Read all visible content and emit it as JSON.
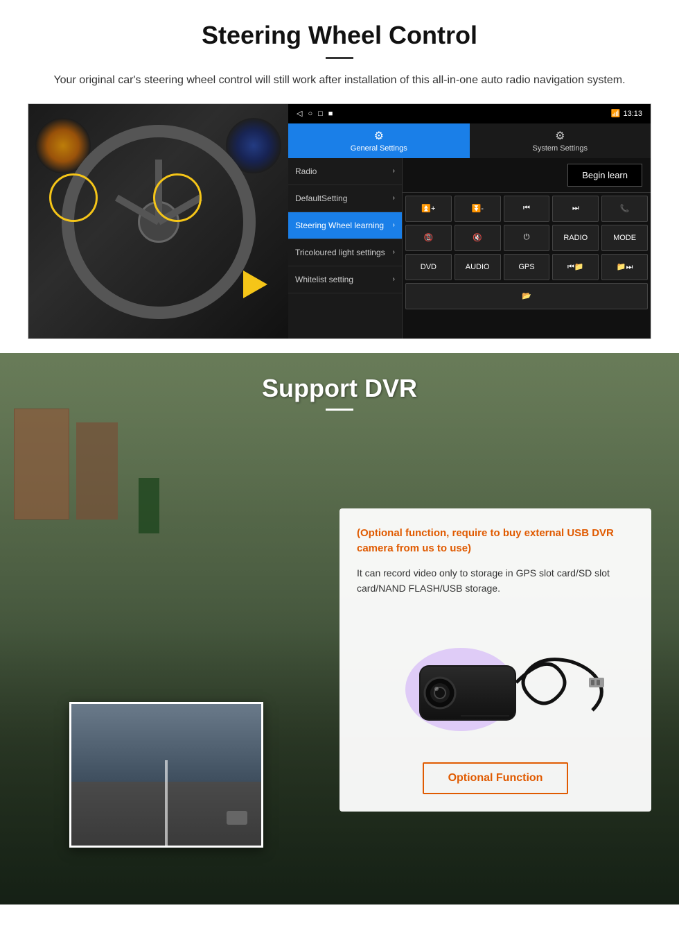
{
  "section1": {
    "title": "Steering Wheel Control",
    "subtitle": "Your original car's steering wheel control will still work after installation of this all-in-one auto radio navigation system.",
    "tabs": {
      "general": "General Settings",
      "system": "System Settings"
    },
    "menu": {
      "items": [
        {
          "label": "Radio",
          "active": false
        },
        {
          "label": "DefaultSetting",
          "active": false
        },
        {
          "label": "Steering Wheel learning",
          "active": true
        },
        {
          "label": "Tricoloured light settings",
          "active": false
        },
        {
          "label": "Whitelist setting",
          "active": false
        }
      ]
    },
    "begin_learn": "Begin learn",
    "controls": {
      "row1": [
        "vol+",
        "vol-",
        "prev",
        "next",
        "phone"
      ],
      "row2": [
        "hang_up",
        "mute",
        "power",
        "RADIO",
        "MODE"
      ],
      "row3": [
        "DVD",
        "AUDIO",
        "GPS",
        "prev_track",
        "next_track"
      ],
      "row4": [
        "folder"
      ]
    },
    "statusbar": {
      "time": "13:13",
      "nav_icons": [
        "◁",
        "○",
        "□",
        "■"
      ]
    }
  },
  "section2": {
    "title": "Support DVR",
    "optional_title": "(Optional function, require to buy external USB DVR camera from us to use)",
    "description": "It can record video only to storage in GPS slot card/SD slot card/NAND FLASH/USB storage.",
    "optional_button": "Optional Function"
  }
}
